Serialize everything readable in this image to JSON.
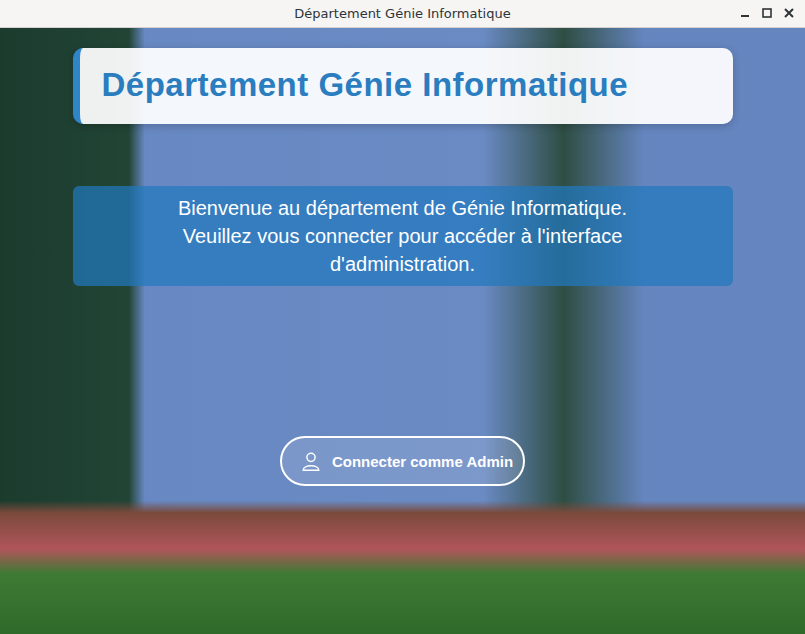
{
  "window": {
    "title": "Département Génie Informatique"
  },
  "header": {
    "title": "Département Génie Informatique"
  },
  "welcome": {
    "lines": [
      "Bienvenue au département de Génie Informatique.",
      "Veuillez vous connecter pour accéder à l'interface d'administration."
    ]
  },
  "login_button": {
    "label": "Connecter comme Admin"
  }
}
